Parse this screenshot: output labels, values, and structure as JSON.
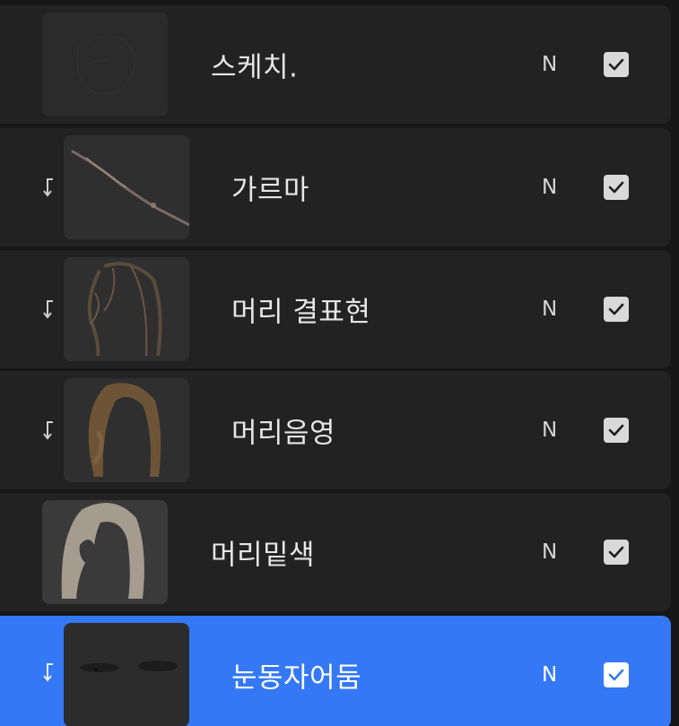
{
  "layers": [
    {
      "name": "스케치.",
      "blend_mode": "N",
      "visible": true,
      "clipped": false,
      "selected": false,
      "thumbnail": "sketch-thumbnail"
    },
    {
      "name": "가르마",
      "blend_mode": "N",
      "visible": true,
      "clipped": true,
      "selected": false,
      "thumbnail": "hair-part-thumbnail"
    },
    {
      "name": "머리 결표현",
      "blend_mode": "N",
      "visible": true,
      "clipped": true,
      "selected": false,
      "thumbnail": "hair-texture-thumbnail"
    },
    {
      "name": "머리음영",
      "blend_mode": "N",
      "visible": true,
      "clipped": true,
      "selected": false,
      "thumbnail": "hair-shade-thumbnail"
    },
    {
      "name": "머리밑색",
      "blend_mode": "N",
      "visible": true,
      "clipped": false,
      "selected": false,
      "thumbnail": "hair-base-thumbnail"
    },
    {
      "name": "눈동자어둠",
      "blend_mode": "N",
      "visible": true,
      "clipped": true,
      "selected": true,
      "thumbnail": "eye-shadow-thumbnail"
    }
  ],
  "colors": {
    "panel_background": "#171717",
    "layer_background": "#222222",
    "selected_accent": "#3478f6",
    "checkbox": "#d9d9d9"
  },
  "icons": {
    "clip": "clipping-mask-arrow-icon",
    "visibility": "checkmark-icon"
  }
}
